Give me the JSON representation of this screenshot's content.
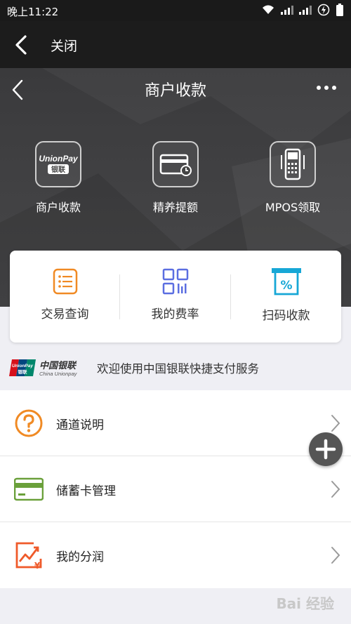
{
  "status_bar": {
    "time": "晚上11:22"
  },
  "top_bar": {
    "close_label": "关闭"
  },
  "hero": {
    "title": "商户收款",
    "features": [
      {
        "label": "商户收款",
        "icon": "unionpay-card-icon",
        "logo_line1": "UnionPay",
        "logo_line2": "银联"
      },
      {
        "label": "精养提额",
        "icon": "credit-card-clock-icon"
      },
      {
        "label": "MPOS领取",
        "icon": "pos-terminal-icon"
      }
    ]
  },
  "quick_actions": [
    {
      "label": "交易查询",
      "icon": "list-document-icon",
      "color": "#f08a24"
    },
    {
      "label": "我的费率",
      "icon": "grid-chart-icon",
      "color": "#5b6ee1"
    },
    {
      "label": "扫码收款",
      "icon": "scan-pay-icon",
      "color": "#17a7d6"
    }
  ],
  "union_banner": {
    "logo_text": "中国银联",
    "logo_sub": "China Unionpay",
    "badge_line1": "UnionPay",
    "badge_line2": "银联",
    "text": "欢迎使用中国银联快捷支付服务"
  },
  "list": [
    {
      "label": "通道说明",
      "icon": "question-circle-icon",
      "color": "#f08a24"
    },
    {
      "label": "储蓄卡管理",
      "icon": "debit-card-icon",
      "color": "#6aa03a"
    },
    {
      "label": "我的分润",
      "icon": "profit-chart-icon",
      "color": "#ef5a2a"
    }
  ],
  "watermark": "Bai 经验"
}
